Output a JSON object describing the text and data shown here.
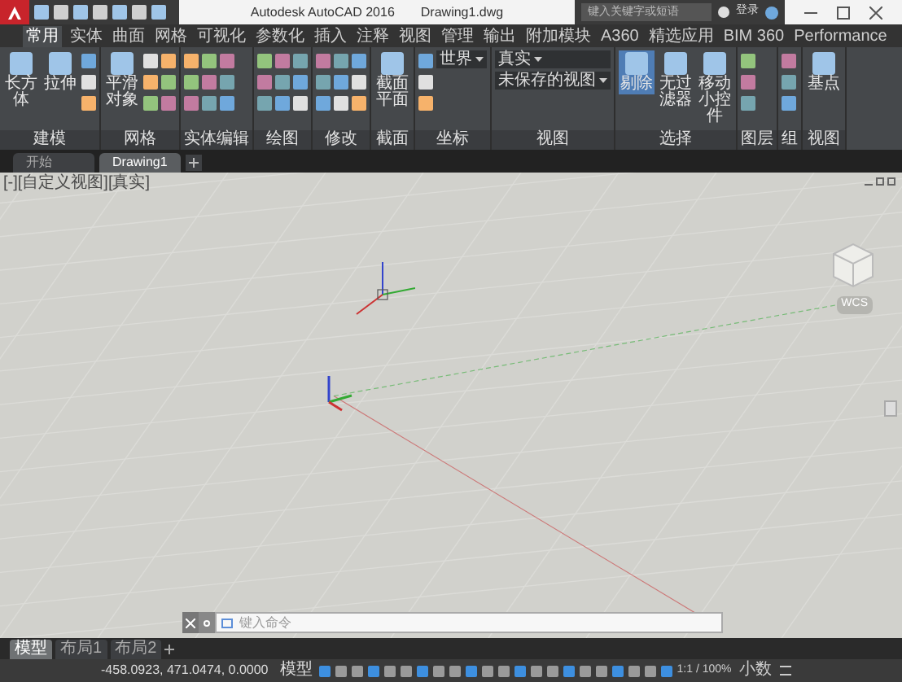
{
  "title_bar": {
    "title": "Autodesk AutoCAD 2016",
    "document": "Drawing1.dwg",
    "search": {
      "placeholder": "键入关键字或短语"
    },
    "login": "登录"
  },
  "ribbon_tabs": [
    {
      "label": "常用",
      "selected": true
    },
    {
      "label": "实体",
      "selected": false
    },
    {
      "label": "曲面",
      "selected": false
    },
    {
      "label": "网格",
      "selected": false
    },
    {
      "label": "可视化",
      "selected": false
    },
    {
      "label": "参数化",
      "selected": false
    },
    {
      "label": "插入",
      "selected": false
    },
    {
      "label": "注释",
      "selected": false
    },
    {
      "label": "视图",
      "selected": false
    },
    {
      "label": "管理",
      "selected": false
    },
    {
      "label": "输出",
      "selected": false
    },
    {
      "label": "附加模块",
      "selected": false
    },
    {
      "label": "A360",
      "selected": false
    },
    {
      "label": "精选应用",
      "selected": false
    },
    {
      "label": "BIM 360",
      "selected": false
    },
    {
      "label": "Performance",
      "selected": false
    }
  ],
  "ribbon_panels": [
    {
      "label": "建模",
      "buttons": [
        {
          "label": "长方体",
          "selected": false
        },
        {
          "label": "拉伸",
          "selected": false
        }
      ]
    },
    {
      "label": "网格",
      "buttons": [
        {
          "label": "平滑对象",
          "selected": false
        }
      ]
    },
    {
      "label": "实体编辑"
    },
    {
      "label": "绘图"
    },
    {
      "label": "修改"
    },
    {
      "label": "截面",
      "buttons": [
        {
          "label": "截面平面",
          "selected": false
        }
      ]
    },
    {
      "label": "坐标",
      "dropdowns": [
        "世界"
      ]
    },
    {
      "label": "视图",
      "dropdowns": [
        "真实",
        "未保存的视图"
      ]
    },
    {
      "label": "选择",
      "buttons": [
        {
          "label": "剔除",
          "selected": true
        },
        {
          "label": "无过滤器",
          "selected": false
        },
        {
          "label": "移动小控件",
          "selected": false
        }
      ]
    },
    {
      "label": "图层"
    },
    {
      "label": "组"
    },
    {
      "label": "视图",
      "buttons": [
        {
          "label": "基点",
          "selected": false
        }
      ]
    }
  ],
  "file_tabs": [
    {
      "label": "开始",
      "selected": false
    },
    {
      "label": "Drawing1",
      "selected": true
    }
  ],
  "viewport": {
    "label": "[-][自定义视图][真实]",
    "ucs_label": "WCS"
  },
  "command_line": {
    "placeholder": "键入命令"
  },
  "layout_tabs": [
    {
      "label": "模型",
      "selected": true
    },
    {
      "label": "布局1",
      "selected": false
    },
    {
      "label": "布局2",
      "selected": false
    }
  ],
  "status_bar": {
    "coordinates": "-458.0923, 471.0474, 0.0000",
    "space": "模型",
    "scale": "1:1 / 100%",
    "units": "小数"
  }
}
